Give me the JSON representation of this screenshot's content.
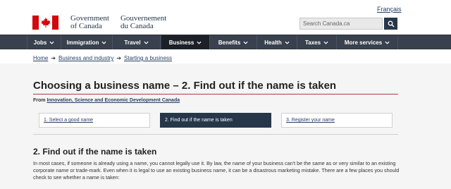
{
  "header": {
    "language_link": "Français",
    "wordmark_en": [
      "Government",
      "of Canada"
    ],
    "wordmark_fr": [
      "Gouvernement",
      "du Canada"
    ],
    "search_placeholder": "Search Canada.ca",
    "flag_color": "#d3080c"
  },
  "menu": {
    "items": [
      {
        "label": "Jobs"
      },
      {
        "label": "Immigration"
      },
      {
        "label": "Travel"
      },
      {
        "label": "Business"
      },
      {
        "label": "Benefits"
      },
      {
        "label": "Health"
      },
      {
        "label": "Taxes"
      },
      {
        "label": "More services"
      }
    ],
    "active": "Business"
  },
  "breadcrumb": [
    "Home",
    "Business and industry",
    "Starting a business"
  ],
  "page": {
    "title": "Choosing a business name – 2. Find out if the name is taken",
    "from_label": "From",
    "from_org": "Innovation, Science and Economic Development Canada"
  },
  "steps": [
    {
      "label": "1. Select a good name",
      "current": false
    },
    {
      "label": "2. Find out if the name is taken",
      "current": true
    },
    {
      "label": "3. Register your name",
      "current": false
    }
  ],
  "section": {
    "heading": "2. Find out if the name is taken",
    "paragraph": "In most cases, if someone is already using a name, you cannot legally use it. By law, the name of your business can't be the same as or very similar to an existing corporate name or trade-mark. Even when it is legal to use an existing business name, it can be a disastrous marketing mistake. There are a few places you should check to see whether a name is taken:"
  },
  "colors": {
    "menu_bg": "#38414d",
    "menu_active": "#1c2128",
    "accent_rule": "#af3c43",
    "current_step": "#26374a",
    "link": "#284162"
  }
}
